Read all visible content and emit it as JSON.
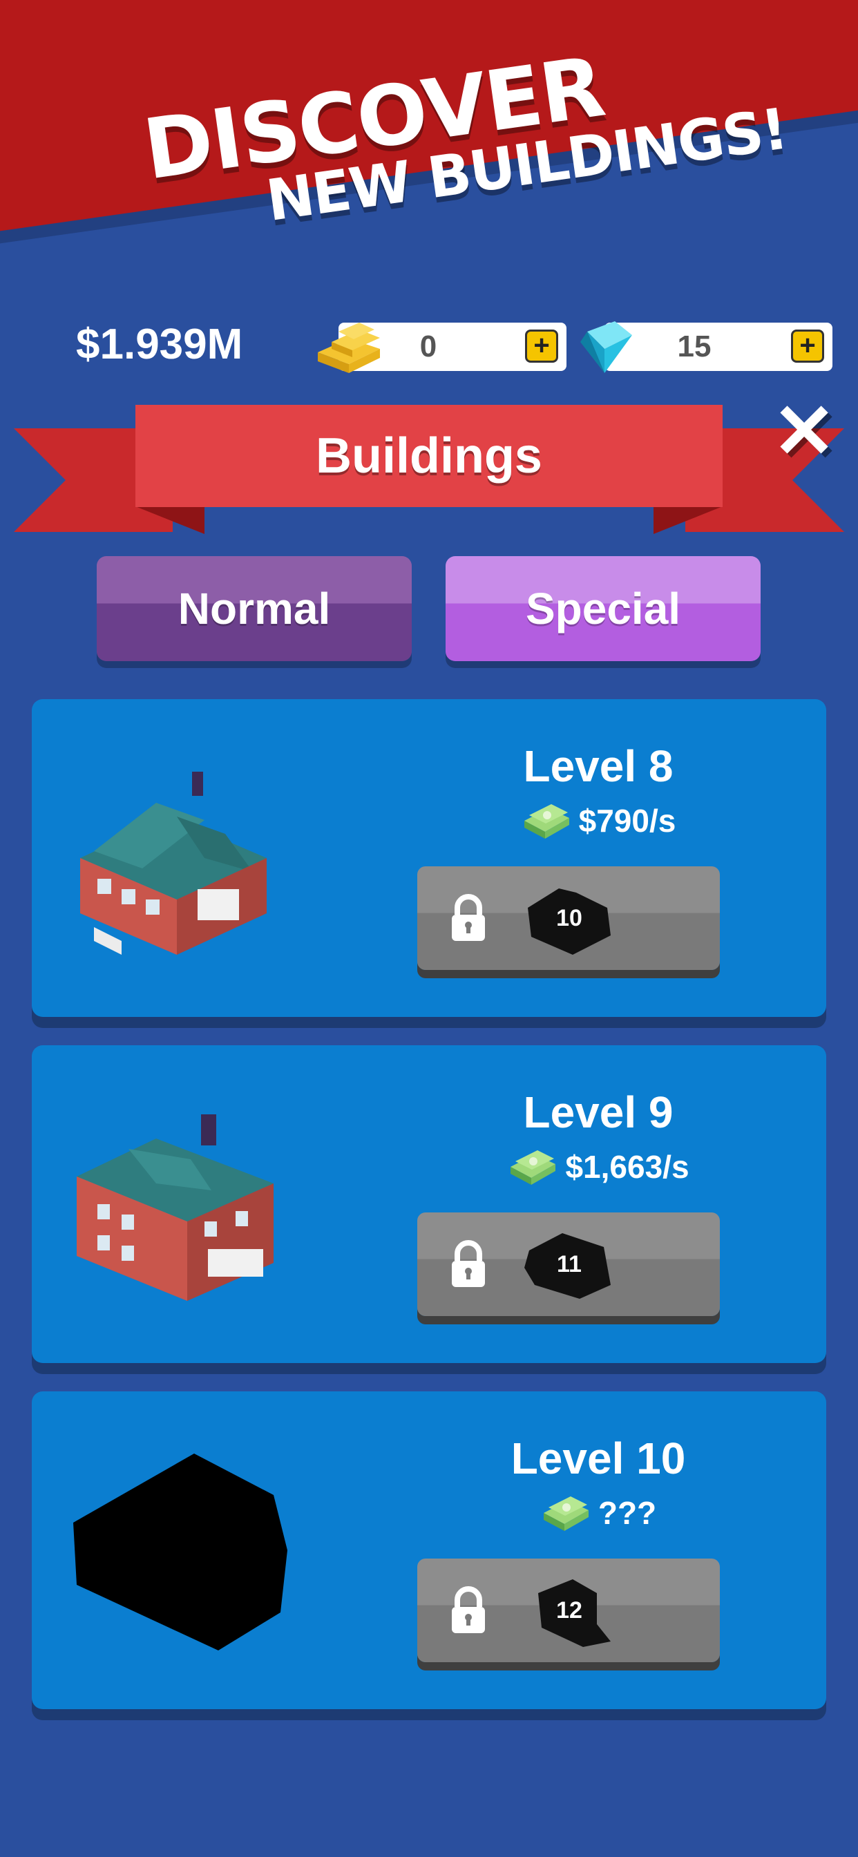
{
  "promo": {
    "line1": "DISCOVER",
    "line2": "NEW BUILDINGS!"
  },
  "currency": {
    "money": "$1.939M",
    "gold": {
      "icon": "gold-bars-icon",
      "value": "0",
      "plus": "+"
    },
    "gems": {
      "icon": "gem-icon",
      "value": "15",
      "plus": "+"
    }
  },
  "header": {
    "title": "Buildings",
    "close": "✕"
  },
  "tabs": [
    {
      "label": "Normal",
      "active": false
    },
    {
      "label": "Special",
      "active": true
    }
  ],
  "buildings": [
    {
      "level": "Level 8",
      "rate": "$790/s",
      "unlock": "10",
      "locked": true,
      "revealed": true
    },
    {
      "level": "Level 9",
      "rate": "$1,663/s",
      "unlock": "11",
      "locked": true,
      "revealed": true
    },
    {
      "level": "Level 10",
      "rate": "???",
      "unlock": "12",
      "locked": true,
      "revealed": false
    }
  ],
  "colors": {
    "background": "#2a4f9e",
    "banner": "#b5191a",
    "ribbon": "#e24246",
    "card": "#0b7ed0",
    "tab_normal": "#6b3f8c",
    "tab_special": "#b35ee0"
  }
}
